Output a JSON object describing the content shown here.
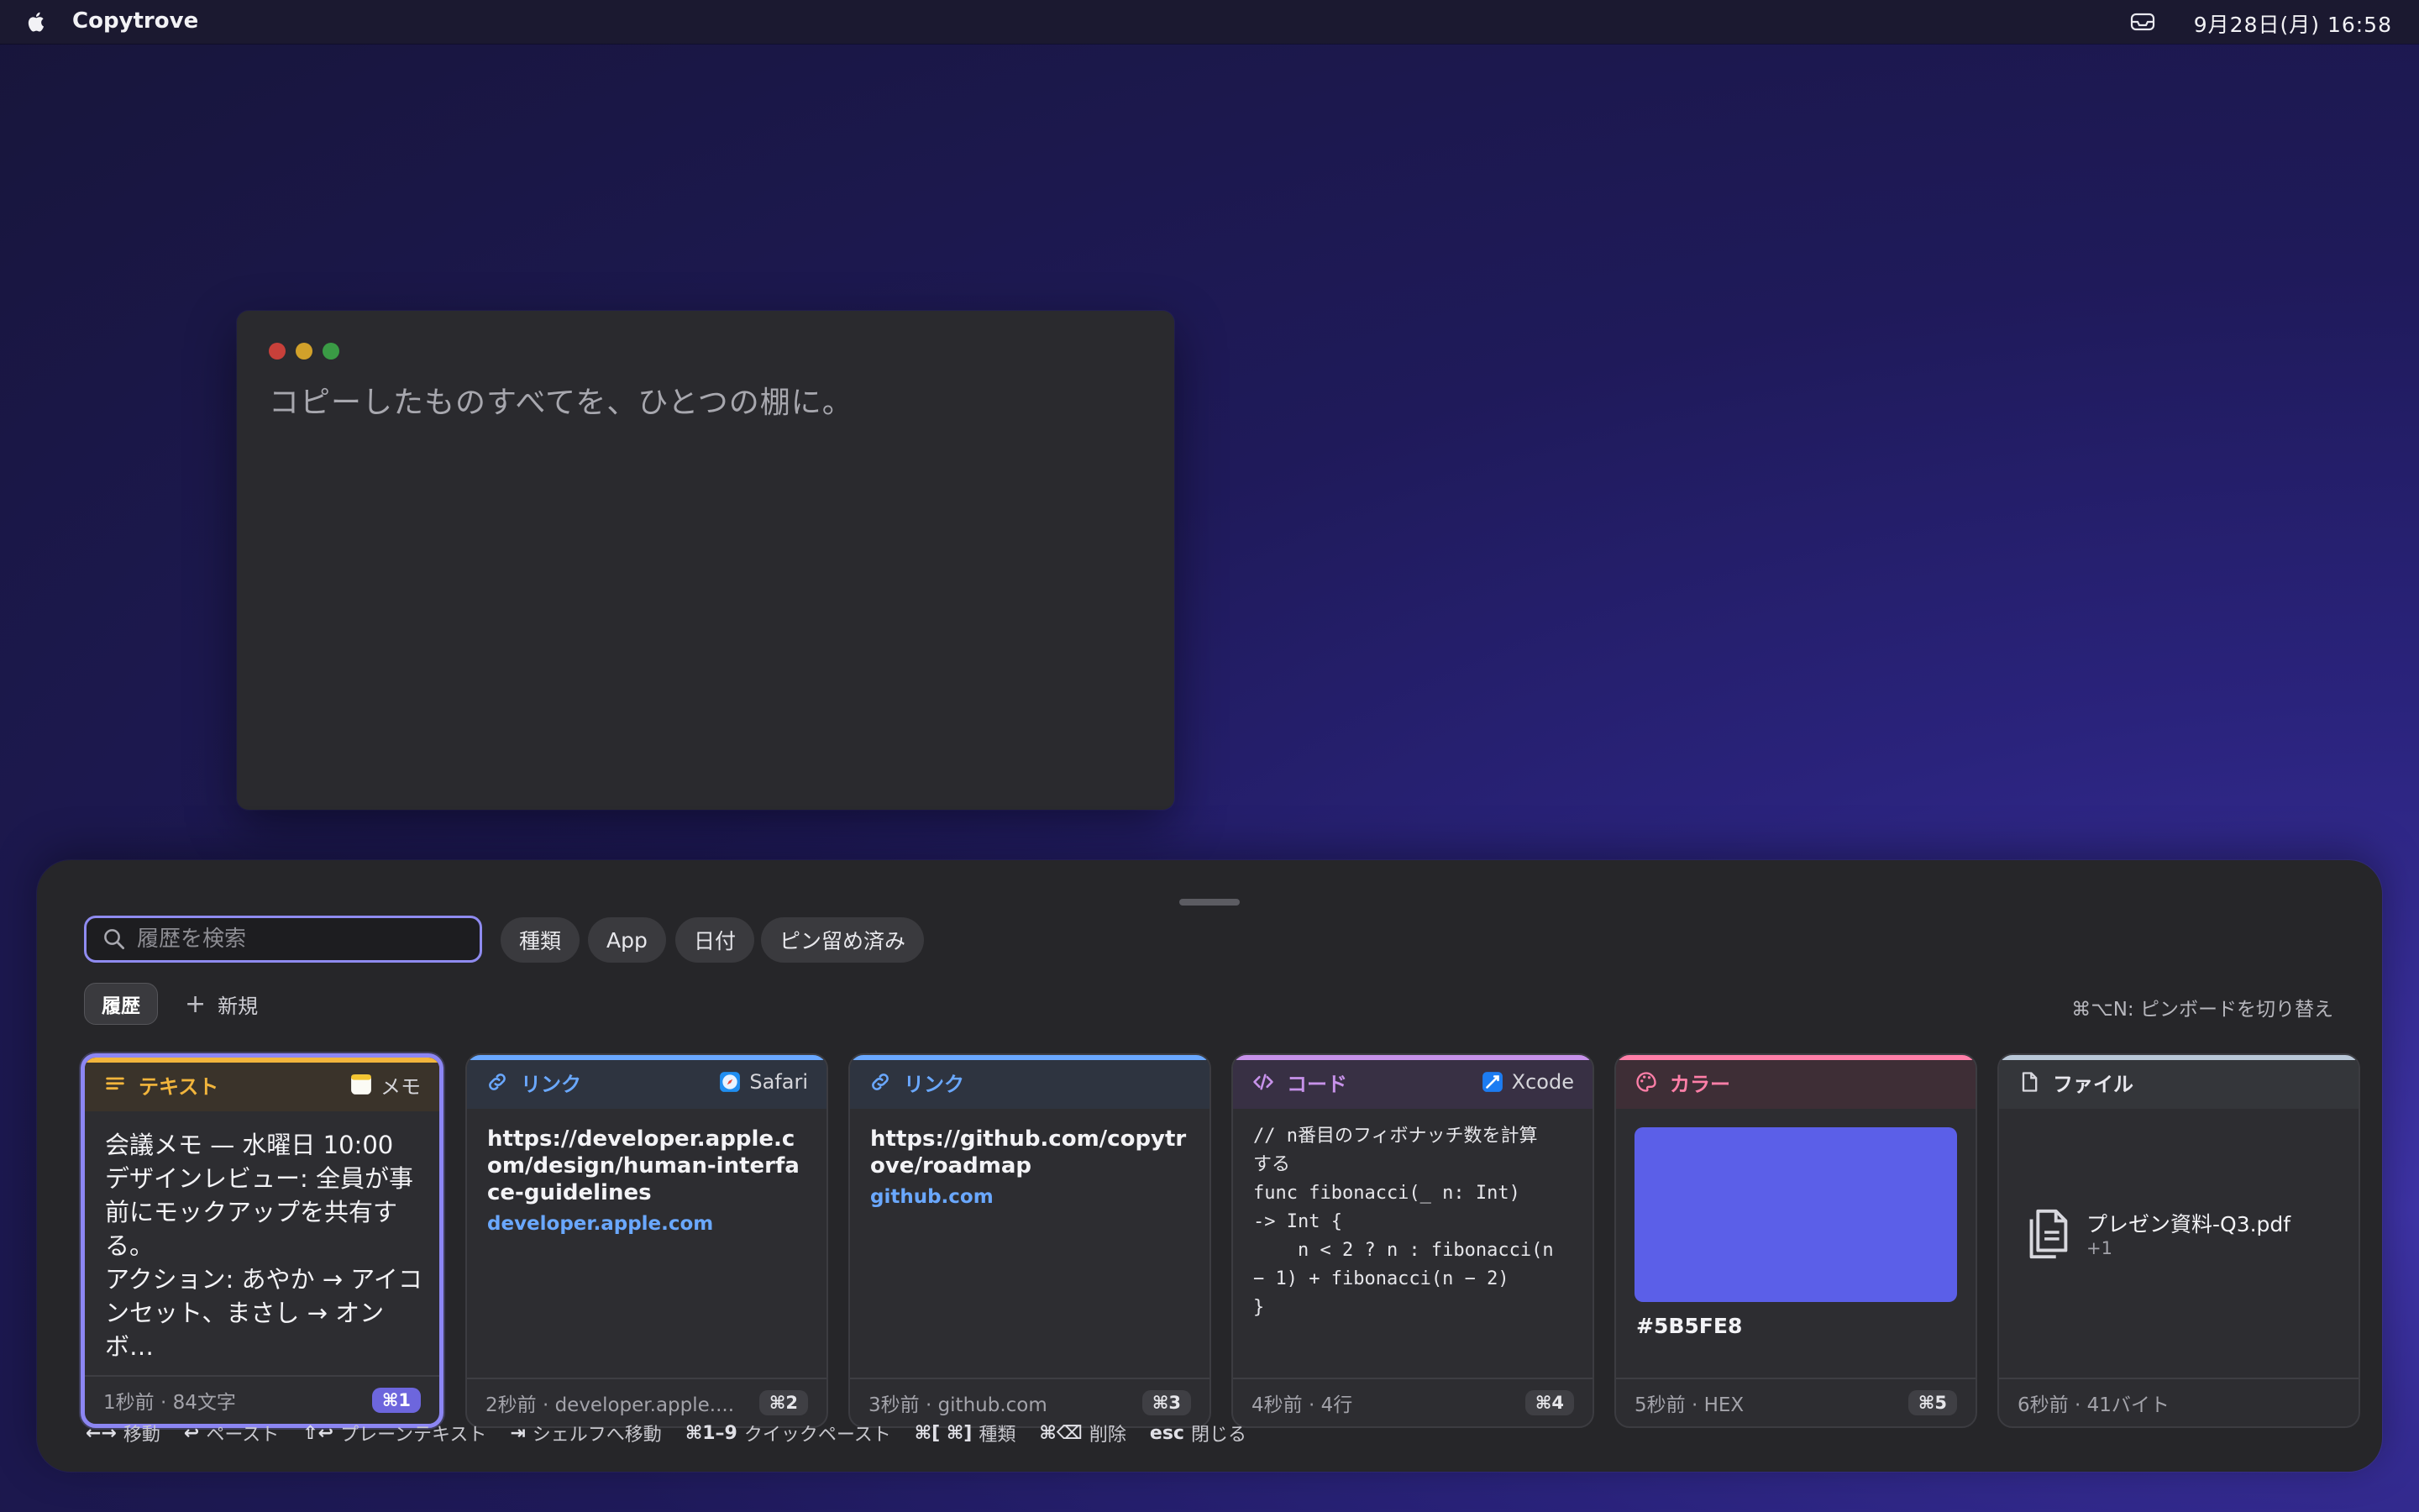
{
  "menubar": {
    "app_name": "Copytrove",
    "clock": "9月28日(月) 16:58"
  },
  "window": {
    "headline": "コピーしたものすべてを、ひとつの棚に。"
  },
  "panel": {
    "search": {
      "placeholder": "履歴を検索",
      "value": ""
    },
    "filters": [
      "種類",
      "App",
      "日付",
      "ピン留め済み"
    ],
    "tabs": {
      "history": "履歴",
      "new": "新規"
    },
    "switch_hint": "⌘⌥N:  ピンボードを切り替え",
    "cards": [
      {
        "type": "テキスト",
        "type_icon": "text-lines-icon",
        "accent": "#f2b53c",
        "source": "メモ",
        "source_icon": "notes-app-icon",
        "content": "会議メモ — 水曜日 10:00\nデザインレビュー: 全員が事\n前にモックアップを共有す\nる。\nアクション: あやか → アイコ\nンセット、まさし → オンボ…",
        "meta": "1秒前 · 84文字",
        "shortcut": "⌘1"
      },
      {
        "type": "リンク",
        "type_icon": "link-icon",
        "accent": "#6aa8ff",
        "source": "Safari",
        "source_icon": "safari-app-icon",
        "url": "https://developer.apple.com/design/human-interface-guidelines",
        "host": "developer.apple.com",
        "meta": "2秒前 · developer.apple....",
        "shortcut": "⌘2"
      },
      {
        "type": "リンク",
        "type_icon": "link-icon",
        "accent": "#6aa8ff",
        "url": "https://github.com/copytrove/roadmap",
        "host": "github.com",
        "meta": "3秒前 · github.com",
        "shortcut": "⌘3"
      },
      {
        "type": "コード",
        "type_icon": "code-brackets-icon",
        "accent": "#c792ea",
        "source": "Xcode",
        "source_icon": "xcode-app-icon",
        "code": "// n番目のフィボナッチ数を計算\nする\nfunc fibonacci(_ n: Int)\n-> Int {\n    n < 2 ? n : fibonacci(n\n− 1) + fibonacci(n − 2)\n}",
        "meta": "4秒前 · 4行",
        "shortcut": "⌘4"
      },
      {
        "type": "カラー",
        "type_icon": "palette-icon",
        "accent": "#ff7fa8",
        "color": "#5B5FE8",
        "color_label": "#5B5FE8",
        "meta": "5秒前 · HEX",
        "shortcut": "⌘5"
      },
      {
        "type": "ファイル",
        "type_icon": "document-icon",
        "accent": "#b9c8d8",
        "file_name": "プレゼン資料-Q3.pdf",
        "file_more": "+1",
        "meta": "6秒前 · 41バイト"
      }
    ],
    "shortcuts": [
      {
        "key": "←→",
        "label": "移動"
      },
      {
        "key": "↩",
        "label": "ペースト"
      },
      {
        "key": "⇧↩",
        "label": "プレーンテキスト"
      },
      {
        "key": "⇥",
        "label": "シェルフへ移動"
      },
      {
        "key": "⌘1–9",
        "label": "クイックペースト"
      },
      {
        "key": "⌘[ ⌘]",
        "label": "種類"
      },
      {
        "key": "⌘⌫",
        "label": "削除"
      },
      {
        "key": "esc",
        "label": "閉じる"
      }
    ]
  }
}
